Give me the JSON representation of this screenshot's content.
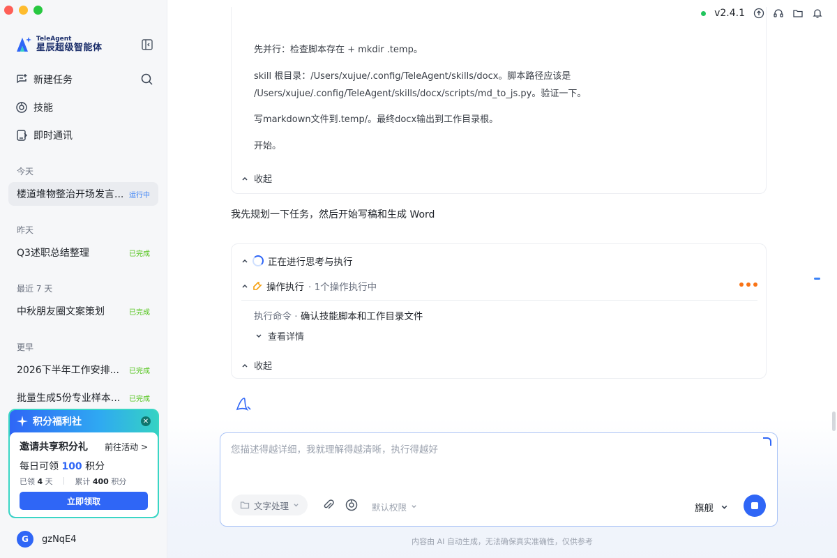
{
  "app": {
    "brand_en": "TeleAgent",
    "brand_cn": "星辰超级智能体",
    "version": "v2.4.1"
  },
  "sidebar": {
    "nav": [
      {
        "label": "新建任务",
        "icon": "new-task-icon"
      },
      {
        "label": "技能",
        "icon": "skills-icon"
      },
      {
        "label": "即时通讯",
        "icon": "im-icon"
      }
    ],
    "sections": [
      {
        "title": "今天",
        "tasks": [
          {
            "title": "楼道堆物整治开场发言...",
            "status": "运行中"
          }
        ]
      },
      {
        "title": "昨天",
        "tasks": [
          {
            "title": "Q3述职总结整理",
            "status": "已完成"
          }
        ]
      },
      {
        "title": "最近 7 天",
        "tasks": [
          {
            "title": "中秋朋友圈文案策划",
            "status": "已完成"
          }
        ]
      },
      {
        "title": "更早",
        "tasks": [
          {
            "title": "2026下半年工作安排...",
            "status": "已完成"
          },
          {
            "title": "批量生成5份专业样本...",
            "status": "已完成"
          }
        ]
      }
    ],
    "points": {
      "header": "积分福利社",
      "title": "邀请共享积分礼",
      "link": "前往活动 >",
      "daily_prefix": "每日可领",
      "daily_value": "100",
      "daily_suffix": "积分",
      "claimed_prefix": "已领",
      "claimed_days": "4",
      "claimed_suffix": "天",
      "total_prefix": "累计",
      "total_value": "400",
      "total_suffix": "积分",
      "button": "立即领取"
    },
    "user": {
      "initial": "G",
      "name": "gzNqE4"
    }
  },
  "main": {
    "think_lines": [
      "先并行：检查脚本存在 + mkdir .temp。",
      "skill 根目录：/Users/xujue/.config/TeleAgent/skills/docx。脚本路径应该是",
      "/Users/xujue/.config/TeleAgent/skills/docx/scripts/md_to_js.py。验证一下。",
      "写markdown文件到.temp/。最终docx输出到工作目录根。",
      "开始。"
    ],
    "collapse_label": "收起",
    "plan_text": "我先规划一下任务，然后开始写稿和生成 Word",
    "exec": {
      "thinking_label": "正在进行思考与执行",
      "op_label": "操作执行",
      "op_sub": "· 1个操作执行中",
      "cmd_label": "执行命令 ·",
      "cmd_text": "确认技能脚本和工作目录文件",
      "detail_label": "查看详情",
      "collapse_label": "收起"
    }
  },
  "composer": {
    "placeholder": "您描述得越详细，我就理解得越清晰，执行得越好",
    "mode": "文字处理",
    "permission": "默认权限",
    "model": "旗舰"
  },
  "disclaimer": "内容由 AI 自动生成，无法确保真实准确性，仅供参考",
  "colors": {
    "accent": "#2f66f6",
    "success": "#52c41a",
    "running": "#3b82f6",
    "warning": "#f97316"
  }
}
